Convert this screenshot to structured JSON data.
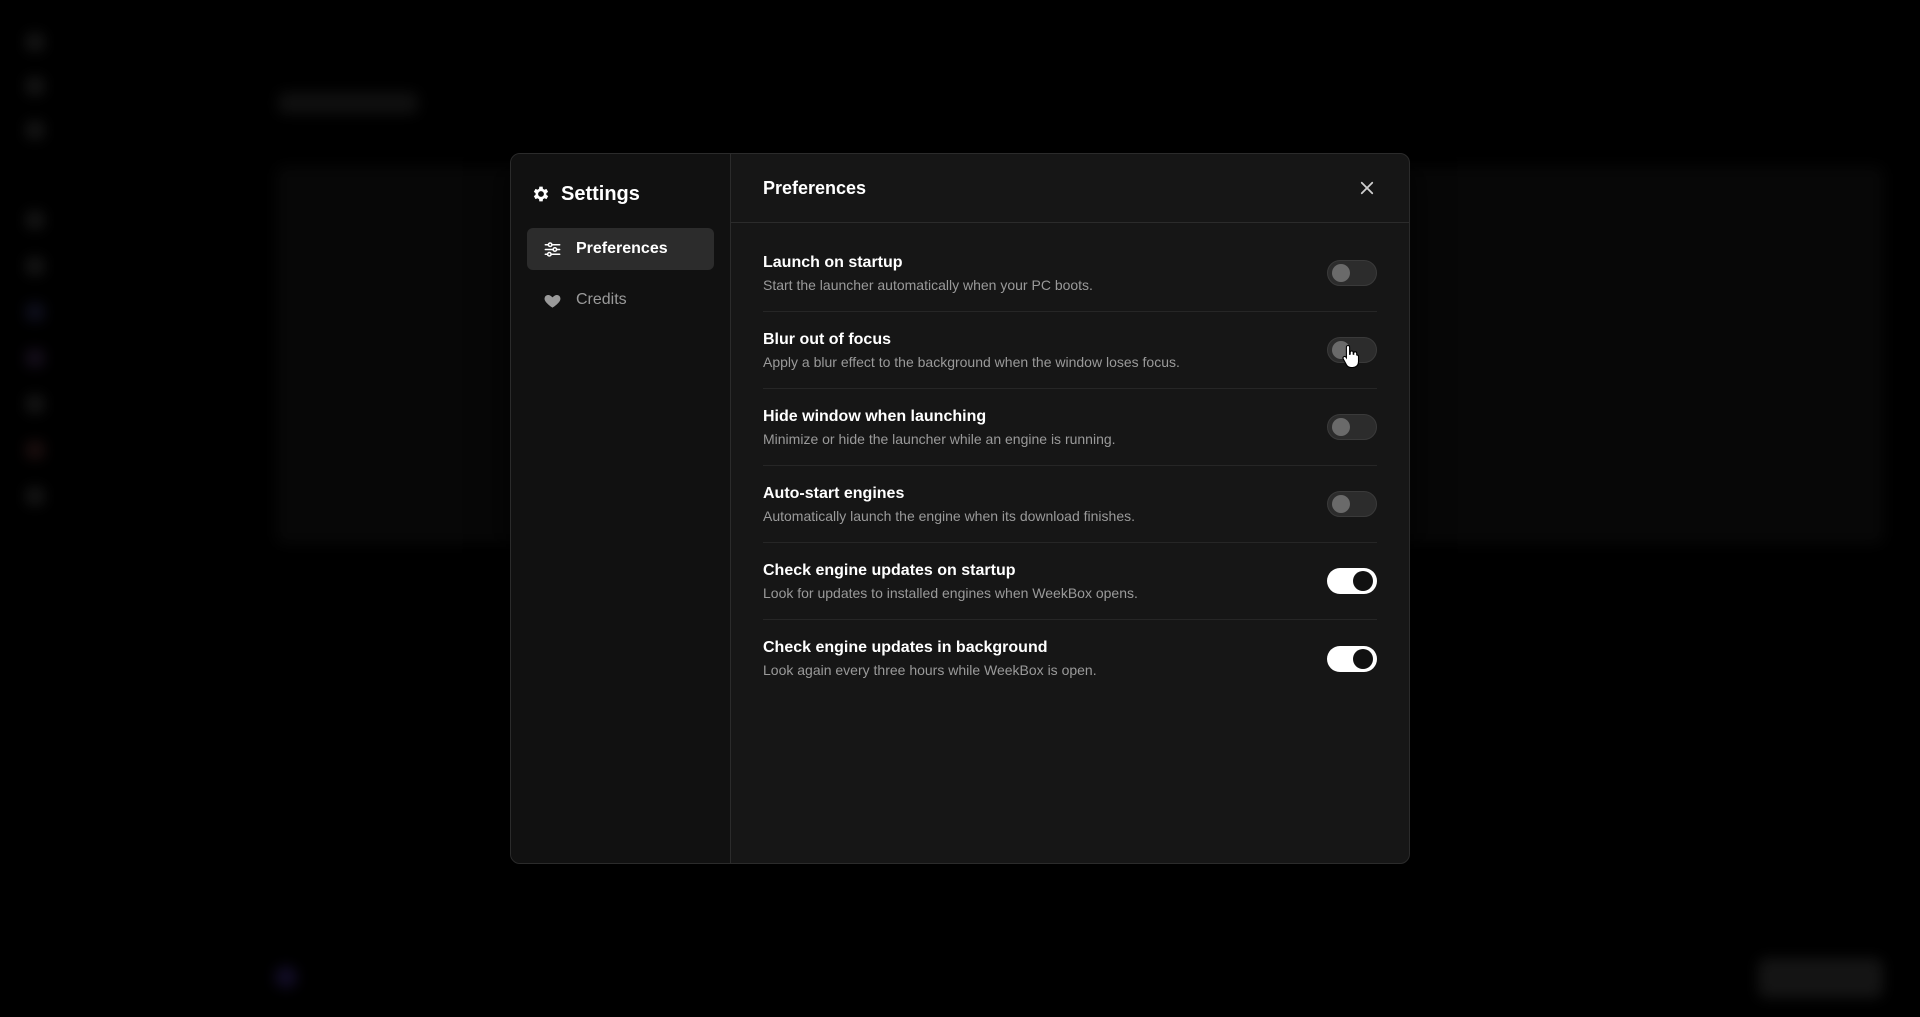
{
  "modal": {
    "title": "Settings",
    "tabs": [
      {
        "label": "Preferences",
        "icon": "sliders-icon",
        "active": true
      },
      {
        "label": "Credits",
        "icon": "heart-icon",
        "active": false
      }
    ],
    "panel_title": "Preferences",
    "settings": [
      {
        "title": "Launch on startup",
        "description": "Start the launcher automatically when your PC boots.",
        "enabled": false
      },
      {
        "title": "Blur out of focus",
        "description": "Apply a blur effect to the background when the window loses focus.",
        "enabled": false
      },
      {
        "title": "Hide window when launching",
        "description": "Minimize or hide the launcher while an engine is running.",
        "enabled": false
      },
      {
        "title": "Auto-start engines",
        "description": "Automatically launch the engine when its download finishes.",
        "enabled": false
      },
      {
        "title": "Check engine updates on startup",
        "description": "Look for updates to installed engines when WeekBox opens.",
        "enabled": true
      },
      {
        "title": "Check engine updates in background",
        "description": "Look again every three hours while WeekBox is open.",
        "enabled": true
      }
    ]
  },
  "colors": {
    "backdrop": "#000000",
    "modal_bg": "#161616",
    "sidebar_bg": "#111111",
    "active_tab_bg": "#2c2c2c",
    "toggle_on": "#ffffff",
    "toggle_off": "#2c2c2c"
  }
}
